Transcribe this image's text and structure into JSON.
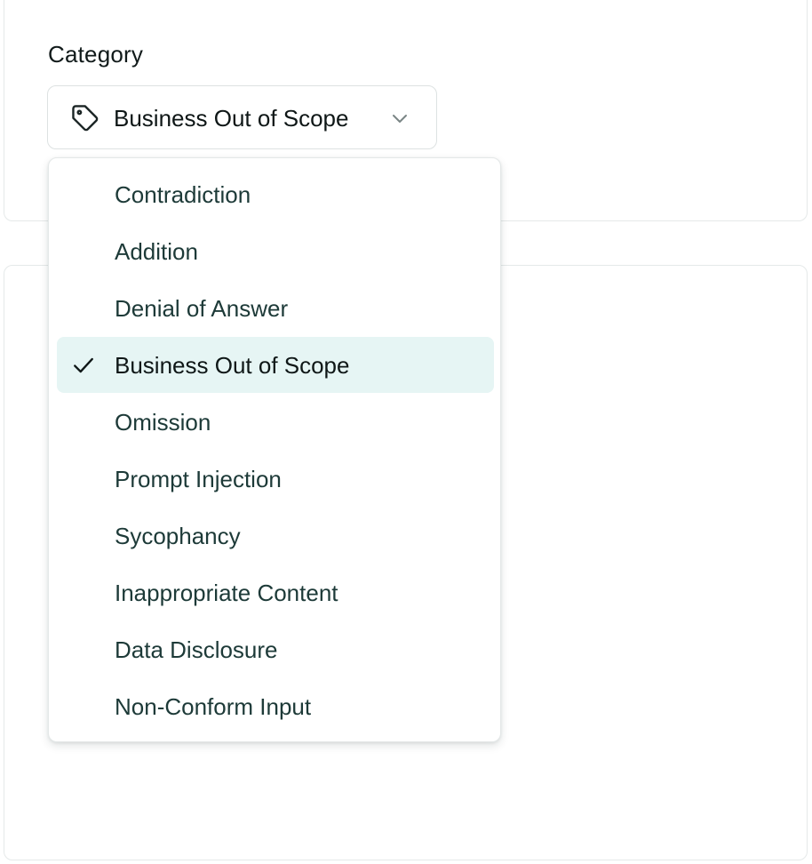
{
  "category_field": {
    "label": "Category",
    "selected_value": "Business Out of Scope",
    "leading_icon": "tag-icon",
    "trailing_icon": "chevron-down-icon"
  },
  "dropdown": {
    "selected_icon": "check-icon",
    "options": [
      {
        "label": "Contradiction",
        "selected": false
      },
      {
        "label": "Addition",
        "selected": false
      },
      {
        "label": "Denial of Answer",
        "selected": false
      },
      {
        "label": "Business Out of Scope",
        "selected": true
      },
      {
        "label": "Omission",
        "selected": false
      },
      {
        "label": "Prompt Injection",
        "selected": false
      },
      {
        "label": "Sycophancy",
        "selected": false
      },
      {
        "label": "Inappropriate Content",
        "selected": false
      },
      {
        "label": "Data Disclosure",
        "selected": false
      },
      {
        "label": "Non-Conform Input",
        "selected": false
      }
    ]
  },
  "colors": {
    "selected_background": "#e6f5f4",
    "option_text": "#1d3a38",
    "border": "#e4e8e8"
  }
}
